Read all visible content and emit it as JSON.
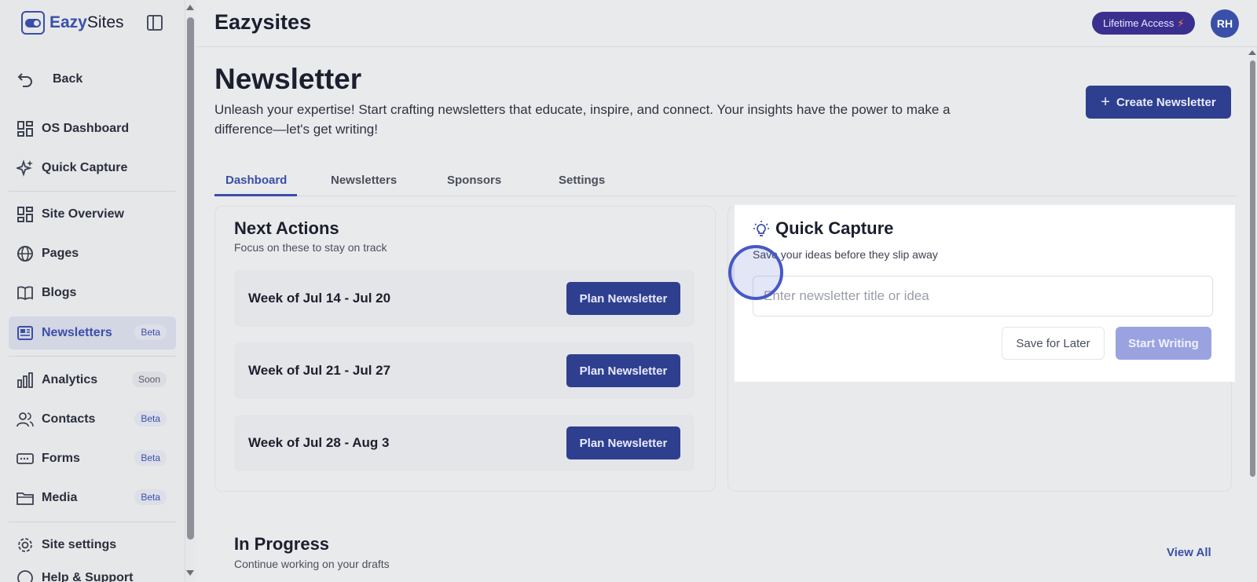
{
  "brand": {
    "name_bold": "Eazy",
    "name_rest": "Sites"
  },
  "sidebar": {
    "back": "Back",
    "items": [
      {
        "label": "OS Dashboard",
        "icon": "dashboard-grid-icon"
      },
      {
        "label": "Quick Capture",
        "icon": "sparkle-icon"
      },
      {
        "label": "Site Overview",
        "icon": "dashboard-grid-icon"
      },
      {
        "label": "Pages",
        "icon": "globe-icon"
      },
      {
        "label": "Blogs",
        "icon": "book-icon"
      },
      {
        "label": "Newsletters",
        "icon": "newspaper-icon",
        "badge": "Beta",
        "active": true
      },
      {
        "label": "Analytics",
        "icon": "bar-chart-icon",
        "badge": "Soon"
      },
      {
        "label": "Contacts",
        "icon": "users-icon",
        "badge": "Beta"
      },
      {
        "label": "Forms",
        "icon": "form-icon",
        "badge": "Beta"
      },
      {
        "label": "Media",
        "icon": "folder-icon",
        "badge": "Beta"
      },
      {
        "label": "Site settings",
        "icon": "gear-icon"
      },
      {
        "label": "Help & Support",
        "icon": "help-icon"
      }
    ]
  },
  "header": {
    "title": "Eazysites",
    "lifetime": "Lifetime Access",
    "lifetime_icon": "⚡",
    "avatar": "RH"
  },
  "page": {
    "title": "Newsletter",
    "description": "Unleash your expertise! Start crafting newsletters that educate, inspire, and connect. Your insights have the power to make a difference—let's get writing!",
    "create_button": "Create Newsletter"
  },
  "tabs": [
    "Dashboard",
    "Newsletters",
    "Sponsors",
    "Settings"
  ],
  "next_actions": {
    "title": "Next Actions",
    "subtitle": "Focus on these to stay on track",
    "weeks": [
      {
        "label": "Week of Jul 14 - Jul 20",
        "button": "Plan Newsletter"
      },
      {
        "label": "Week of Jul 21 - Jul 27",
        "button": "Plan Newsletter"
      },
      {
        "label": "Week of Jul 28 - Aug 3",
        "button": "Plan Newsletter"
      }
    ]
  },
  "in_progress": {
    "title": "In Progress",
    "subtitle": "Continue working on your drafts",
    "view_all": "View All"
  },
  "quick_capture": {
    "title": "Quick Capture",
    "subtitle": "Save your ideas before they slip away",
    "input_placeholder": "Enter newsletter title or idea",
    "input_value": "",
    "save_later": "Save for Later",
    "start_writing": "Start Writing"
  },
  "colors": {
    "accent": "#3a4fa8",
    "button": "#2f3f8f",
    "lifetime": "#3a2f8f"
  }
}
